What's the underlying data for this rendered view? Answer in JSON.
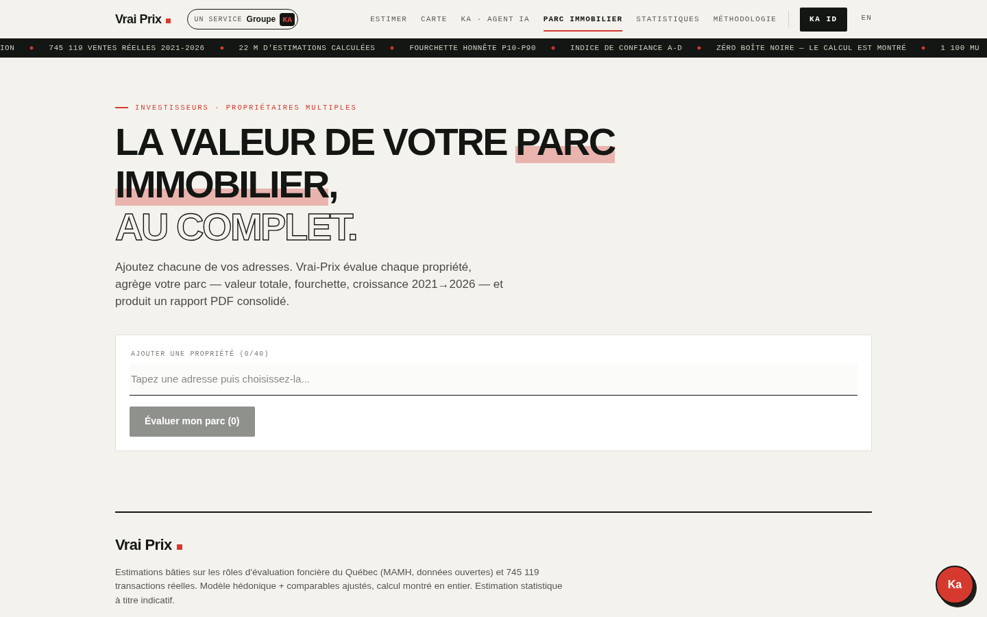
{
  "header": {
    "logo": "Vrai Prix",
    "service_pill": {
      "prefix": "UN SERVICE",
      "brand": "Groupe",
      "badge": "KA"
    },
    "nav": [
      {
        "label": "ESTIMER",
        "selected": false
      },
      {
        "label": "CARTE",
        "selected": false
      },
      {
        "label": "KA · AGENT IA",
        "selected": false
      },
      {
        "label": "PARC IMMOBILIER",
        "selected": true
      },
      {
        "label": "STATISTIQUES",
        "selected": false
      },
      {
        "label": "MÉTHODOLOGIE",
        "selected": false
      }
    ],
    "account_button": "KA ID",
    "language": "EN"
  },
  "ticker": [
    "ION",
    "745 119 VENTES RÉELLES 2021-2026",
    "22 M D'ESTIMATIONS CALCULÉES",
    "FOURCHETTE HONNÊTE P10-P90",
    "INDICE DE CONFIANCE A-D",
    "ZÉRO BOÎTE NOIRE — LE CALCUL EST MONTRÉ",
    "1 100 MU"
  ],
  "hero": {
    "eyebrow": "INVESTISSEURS · PROPRIÉTAIRES MULTIPLES",
    "heading": [
      {
        "kind": "solid",
        "segments": [
          {
            "text": "LA VALEUR DE VOTRE ",
            "highlight": false
          },
          {
            "text": "PARC",
            "highlight": true
          }
        ]
      },
      {
        "kind": "solid",
        "segments": [
          {
            "text": "IMMOBILIER",
            "highlight": true
          },
          {
            "text": ",",
            "highlight": false
          }
        ]
      },
      {
        "kind": "outline",
        "segments": [
          {
            "text": "AU COMPLET.",
            "highlight": false
          }
        ]
      }
    ],
    "intro": "Ajoutez chacune de vos adresses. Vrai-Prix évalue chaque propriété, agrège votre parc — valeur totale, fourchette, croissance 2021→2026 — et produit un rapport PDF consolidé."
  },
  "add_property": {
    "label": "AJOUTER UNE PROPRIÉTÉ (0/40)",
    "placeholder": "Tapez une adresse puis choisissez-la...",
    "submit": {
      "label": "Évaluer mon parc (0)",
      "disabled": true
    }
  },
  "footer": {
    "logo": "Vrai Prix",
    "description": "Estimations bâties sur les rôles d'évaluation foncière du Québec (MAMH, données ouvertes) et 745 119 transactions réelles. Modèle hédonique + comparables ajustés, calcul montré en entier. Estimation statistique à titre indicatif."
  },
  "chat_button": {
    "label": "Ka"
  }
}
